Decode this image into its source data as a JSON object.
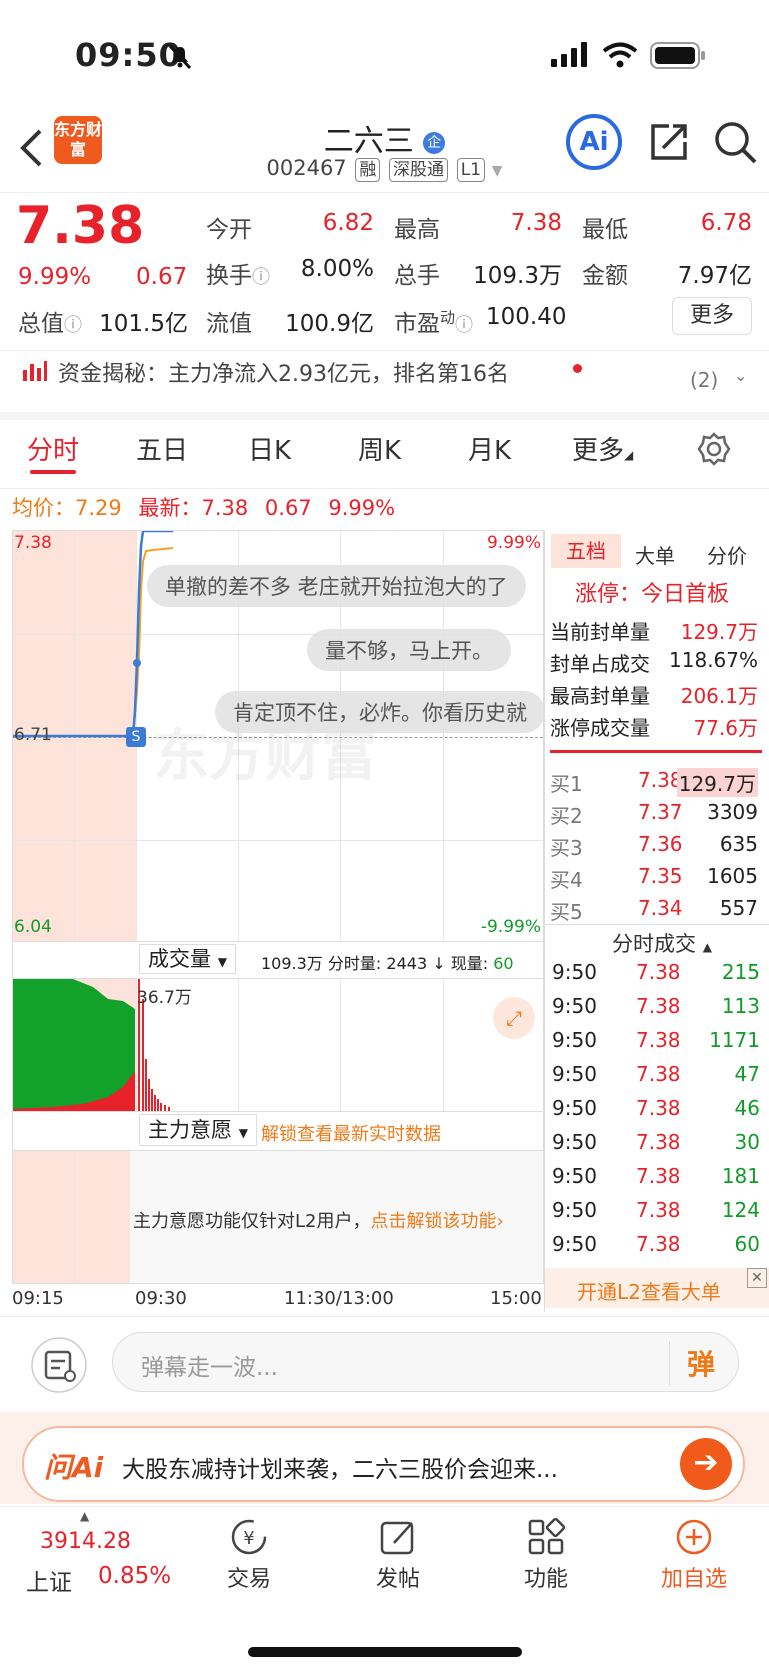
{
  "status_bar": {
    "time": "09:50"
  },
  "header": {
    "logo_text": "东方财富",
    "title": "二六三",
    "title_badge": "企",
    "code": "002467",
    "tags": [
      "融",
      "深股通",
      "L1"
    ],
    "ai_label": "Ai"
  },
  "quote": {
    "price": "7.38",
    "change_pct": "9.99%",
    "change": "0.67",
    "stats": [
      {
        "label": "今开",
        "value": "6.82"
      },
      {
        "label": "最高",
        "value": "7.38"
      },
      {
        "label": "最低",
        "value": "6.78"
      },
      {
        "label": "换手",
        "value": "8.00%"
      },
      {
        "label": "总手",
        "value": "109.3万"
      },
      {
        "label": "金额",
        "value": "7.97亿"
      },
      {
        "label": "总值",
        "value": "101.5亿"
      },
      {
        "label": "流值",
        "value": "100.9亿"
      },
      {
        "label": "市盈",
        "value": "100.40"
      }
    ],
    "pe_sup": "动",
    "more_button": "更多"
  },
  "capital_banner": {
    "text": "资金揭秘：主力净流入2.93亿元，排名第16名",
    "count": "(2)"
  },
  "tabs": [
    "分时",
    "五日",
    "日K",
    "周K",
    "月K",
    "更多"
  ],
  "chart_header": {
    "avg_label": "均价：",
    "avg": "7.29",
    "latest_label": "最新：",
    "latest": "7.38",
    "change": "0.67",
    "pct": "9.99%"
  },
  "chart_labels": {
    "top_price": "7.38",
    "top_pct": "9.99%",
    "mid_price": "6.71",
    "bottom_price": "6.04",
    "bottom_pct": "-9.99%",
    "watermark": "东方财富",
    "marker": "S"
  },
  "danmu": [
    "单撤的差不多 老庄就开始拉泡大的了",
    "量不够，马上开。",
    "肯定顶不住，必炸。你看历史就"
  ],
  "volume_bar": {
    "selector": "成交量",
    "total": "109.3万",
    "period_label": "分时量:",
    "period_value": "2443",
    "now_label": "现量:",
    "now_value": "60",
    "peak_label": "36.7万"
  },
  "intent_bar": {
    "selector": "主力意愿",
    "unlock": "解锁查看最新实时数据",
    "notice": "主力意愿功能仅针对L2用户，",
    "notice_link": "点击解锁该功能"
  },
  "time_axis": [
    "09:15",
    "09:30",
    "11:30/13:00",
    "15:00"
  ],
  "right_panel": {
    "tabs": [
      "五档",
      "大单",
      "分价"
    ],
    "limit_title": "涨停：今日首板",
    "limit_stats": [
      {
        "label": "当前封单量",
        "value": "129.7万"
      },
      {
        "label": "封单占成交",
        "value": "118.67%"
      },
      {
        "label": "最高封单量",
        "value": "206.1万"
      },
      {
        "label": "涨停成交量",
        "value": "77.6万"
      }
    ],
    "bids": [
      {
        "label": "买1",
        "price": "7.38",
        "vol": "129.7万"
      },
      {
        "label": "买2",
        "price": "7.37",
        "vol": "3309"
      },
      {
        "label": "买3",
        "price": "7.36",
        "vol": "635"
      },
      {
        "label": "买4",
        "price": "7.35",
        "vol": "1605"
      },
      {
        "label": "买5",
        "price": "7.34",
        "vol": "557"
      }
    ],
    "ticks_title": "分时成交",
    "ticks": [
      {
        "time": "9:50",
        "price": "7.38",
        "vol": "215"
      },
      {
        "time": "9:50",
        "price": "7.38",
        "vol": "113"
      },
      {
        "time": "9:50",
        "price": "7.38",
        "vol": "1171"
      },
      {
        "time": "9:50",
        "price": "7.38",
        "vol": "47"
      },
      {
        "time": "9:50",
        "price": "7.38",
        "vol": "46"
      },
      {
        "time": "9:50",
        "price": "7.38",
        "vol": "30"
      },
      {
        "time": "9:50",
        "price": "7.38",
        "vol": "181"
      },
      {
        "time": "9:50",
        "price": "7.38",
        "vol": "124"
      },
      {
        "time": "9:50",
        "price": "7.38",
        "vol": "60"
      }
    ],
    "l2_banner": "开通L2查看大单"
  },
  "comment_bar": {
    "placeholder": "弹幕走一波...",
    "danmu_button": "弹"
  },
  "ai_banner": {
    "logo": "问Ai",
    "text": "大股东减持计划来袭，二六三股价会迎来..."
  },
  "bottom_nav": {
    "index_value": "3914.28",
    "index_name": "上证",
    "index_pct": "0.85%",
    "items": [
      "交易",
      "发帖",
      "功能",
      "加自选"
    ]
  }
}
